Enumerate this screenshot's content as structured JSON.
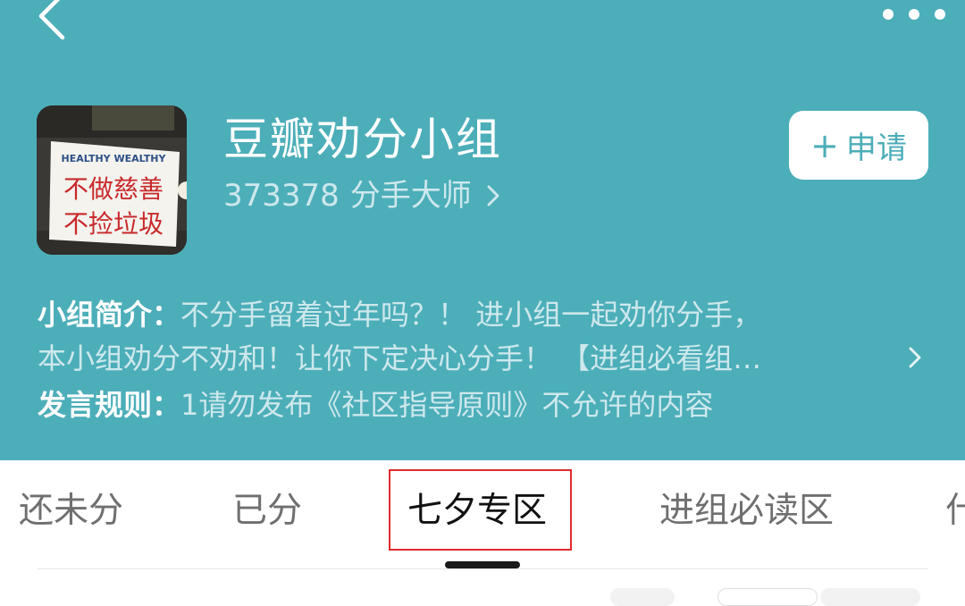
{
  "colors": {
    "header_bg": "#4caeb9",
    "accent": "#4caeb9",
    "highlight_box": "#e02b2b"
  },
  "nav": {
    "back_icon": "chevron-left-icon",
    "more_icon": "more-dots-icon"
  },
  "group": {
    "name": "豆瓣劝分小组",
    "member_count": "373378",
    "member_title": "分手大师",
    "apply_label": "申请",
    "avatar": {
      "sign_header": "HEALTHY WEALTHY",
      "sign_line1": "不做慈善",
      "sign_line2": "不捡垃圾"
    }
  },
  "intro": {
    "label": "小组简介：",
    "line1": "不分手留着过年吗？！ 进小组一起劝你分手，",
    "line2": "本小组劝分不劝和！让你下定决心分手！ 【进组必看组…",
    "rules_label": "发言规则：",
    "rules_text": "1请勿发布《社区指导原则》不允许的内容"
  },
  "tabs": [
    {
      "label": "还未分"
    },
    {
      "label": "已分"
    },
    {
      "label": "七夕专区",
      "active": true
    },
    {
      "label": "进组必读区"
    },
    {
      "label": "什"
    }
  ]
}
